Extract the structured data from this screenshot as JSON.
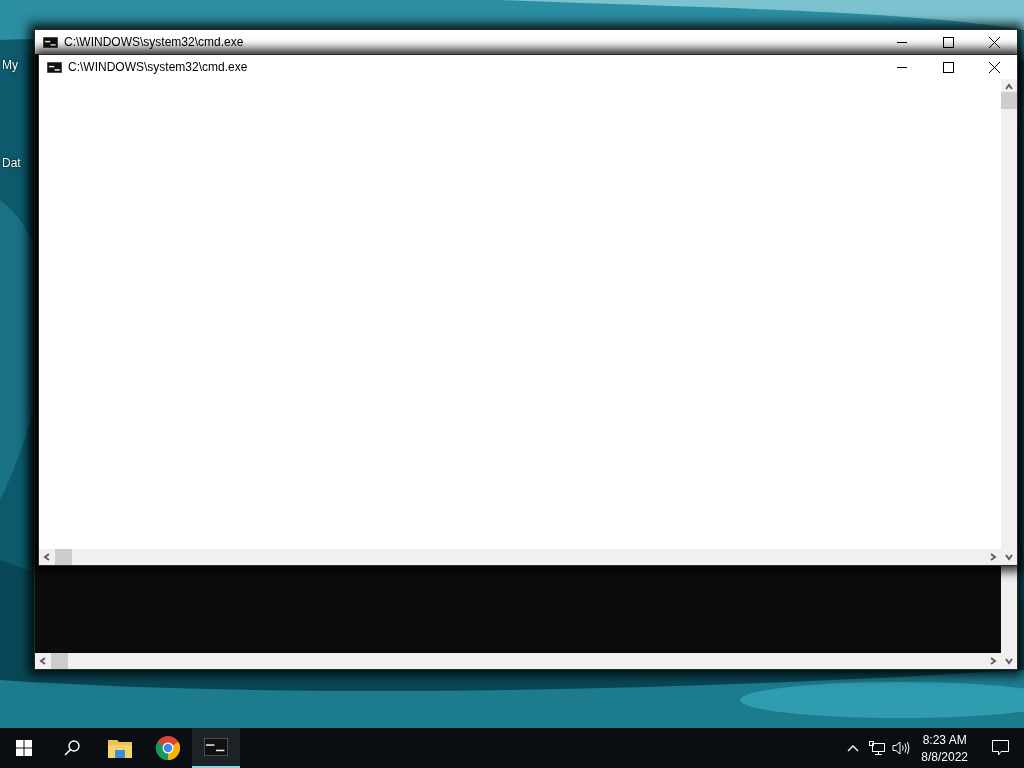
{
  "desktop_icons": [
    {
      "label": "My"
    },
    {
      "label": "Dat"
    }
  ],
  "windows": [
    {
      "title": "C:\\WINDOWS\\system32\\cmd.exe",
      "kind": "console"
    },
    {
      "title": "C:\\WINDOWS\\system32\\cmd.exe",
      "kind": "blank"
    }
  ],
  "taskbar": {
    "apps": [
      {
        "kind": "folder",
        "active": false
      },
      {
        "kind": "browser",
        "active": false
      },
      {
        "kind": "console",
        "active": true
      }
    ],
    "time": "8:23 AM",
    "date": "8/8/2022"
  }
}
